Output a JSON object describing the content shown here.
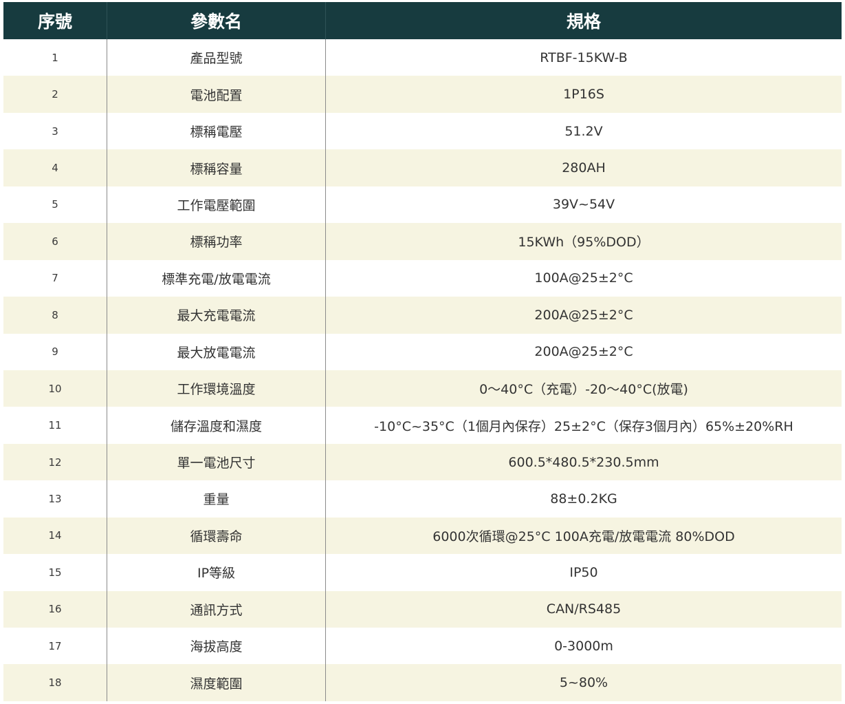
{
  "headers": {
    "no": "序號",
    "name": "參數名",
    "spec": "規格"
  },
  "rows": [
    {
      "no": "1",
      "name": "產品型號",
      "spec": "RTBF-15KW-B"
    },
    {
      "no": "2",
      "name": "電池配置",
      "spec": "1P16S"
    },
    {
      "no": "3",
      "name": "標稱電壓",
      "spec": "51.2V"
    },
    {
      "no": "4",
      "name": "標稱容量",
      "spec": "280AH"
    },
    {
      "no": "5",
      "name": "工作電壓範圍",
      "spec": "39V~54V"
    },
    {
      "no": "6",
      "name": "標稱功率",
      "spec": "15KWh（95%DOD）"
    },
    {
      "no": "7",
      "name": "標準充電/放電電流",
      "spec": "100A@25±2°C"
    },
    {
      "no": "8",
      "name": "最大充電電流",
      "spec": "200A@25±2°C"
    },
    {
      "no": "9",
      "name": "最大放電電流",
      "spec": "200A@25±2°C"
    },
    {
      "no": "10",
      "name": "工作環境溫度",
      "spec": "0～40°C（充電）-20～40°C(放電)"
    },
    {
      "no": "11",
      "name": "儲存溫度和濕度",
      "spec": "-10°C~35°C（1個月內保存）25±2°C（保存3個月內）65%±20%RH"
    },
    {
      "no": "12",
      "name": "單一電池尺寸",
      "spec": "600.5*480.5*230.5mm"
    },
    {
      "no": "13",
      "name": "重量",
      "spec": "88±0.2KG"
    },
    {
      "no": "14",
      "name": "循環壽命",
      "spec": "6000次循環@25°C 100A充電/放電電流 80%DOD"
    },
    {
      "no": "15",
      "name": "IP等級",
      "spec": "IP50"
    },
    {
      "no": "16",
      "name": "通訊方式",
      "spec": "CAN/RS485"
    },
    {
      "no": "17",
      "name": "海拔高度",
      "spec": "0-3000m"
    },
    {
      "no": "18",
      "name": "濕度範圍",
      "spec": "5~80%"
    }
  ]
}
